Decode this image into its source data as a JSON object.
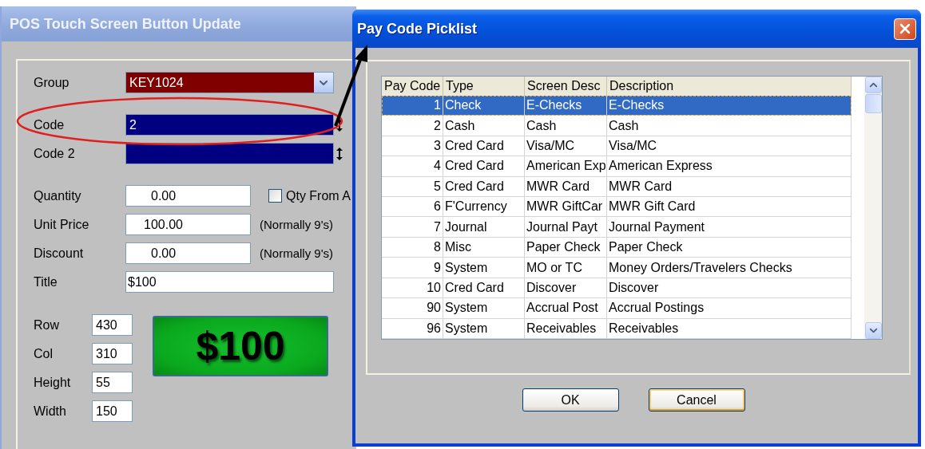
{
  "pos_window": {
    "title": "POS Touch Screen Button Update",
    "field_groups": [
      {
        "fields": [
          {
            "kind": "select",
            "label": "Group",
            "value": "KEY1024"
          }
        ]
      },
      {
        "fields": [
          {
            "kind": "spin",
            "label": "Code",
            "value": "2"
          },
          {
            "kind": "spin",
            "label": "Code 2"
          }
        ]
      },
      {
        "fields": [
          {
            "kind": "number",
            "label": "Quantity",
            "value": "0.00",
            "checkbox": {
              "label": "Qty From A",
              "checked": false
            }
          },
          {
            "kind": "number",
            "label": "Unit Price",
            "value": "100.00",
            "note": "(Normally 9's)"
          },
          {
            "kind": "number",
            "label": "Discount",
            "value": "0.00",
            "note": "(Normally 9's)"
          },
          {
            "kind": "text",
            "label": "Title",
            "value": "$100"
          }
        ]
      }
    ],
    "position_fields": [
      {
        "label": "Row",
        "value": "430"
      },
      {
        "label": "Col",
        "value": "310"
      },
      {
        "label": "Height",
        "value": "55"
      },
      {
        "label": "Width",
        "value": "150"
      }
    ],
    "preview_button": {
      "label": "$100"
    }
  },
  "picklist": {
    "title": "Pay Code Picklist",
    "columns": [
      "Pay Code",
      "Type",
      "Screen Desc",
      "Description"
    ],
    "rows": [
      {
        "cells": [
          "1",
          "Check",
          "E-Checks",
          "E-Checks"
        ],
        "selected": true
      },
      {
        "cells": [
          "2",
          "Cash",
          "Cash",
          "Cash"
        ],
        "selected": false
      },
      {
        "cells": [
          "3",
          "Cred Card",
          "Visa/MC",
          "Visa/MC"
        ],
        "selected": false
      },
      {
        "cells": [
          "4",
          "Cred Card",
          "American Exp",
          "American Express"
        ],
        "selected": false
      },
      {
        "cells": [
          "5",
          "Cred Card",
          "MWR Card",
          "MWR Card"
        ],
        "selected": false
      },
      {
        "cells": [
          "6",
          "F'Currency",
          "MWR GiftCar",
          "MWR Gift Card"
        ],
        "selected": false
      },
      {
        "cells": [
          "7",
          "Journal",
          "Journal Payt",
          "Journal Payment"
        ],
        "selected": false
      },
      {
        "cells": [
          "8",
          "Misc",
          "Paper Check",
          "Paper Check"
        ],
        "selected": false
      },
      {
        "cells": [
          "9",
          "System",
          "MO or TC",
          "Money Orders/Travelers Checks"
        ],
        "selected": false
      },
      {
        "cells": [
          "10",
          "Cred Card",
          "Discover",
          "Discover"
        ],
        "selected": false
      },
      {
        "cells": [
          "90",
          "System",
          "Accrual Post",
          "Accrual Postings"
        ],
        "selected": false
      },
      {
        "cells": [
          "96",
          "System",
          "Receivables",
          "Receivables"
        ],
        "selected": false
      }
    ],
    "buttons": [
      {
        "label": "OK",
        "default": false
      },
      {
        "label": "Cancel",
        "default": true
      }
    ]
  }
}
